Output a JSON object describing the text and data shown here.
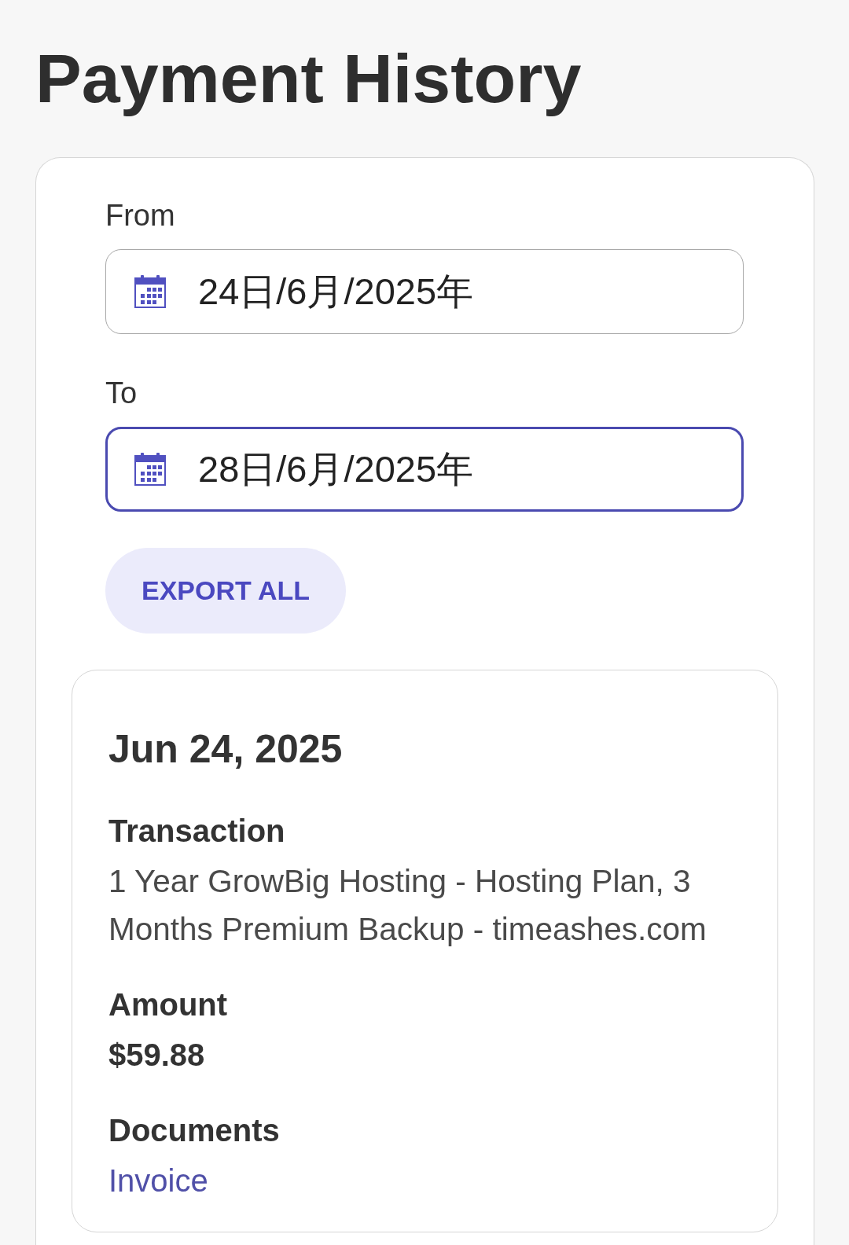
{
  "page": {
    "title": "Payment History"
  },
  "filters": [
    {
      "label": "From",
      "value": "24日/6月/2025年",
      "focused": false
    },
    {
      "label": "To",
      "value": "28日/6月/2025年",
      "focused": true
    }
  ],
  "export_button": {
    "label": "EXPORT ALL"
  },
  "payments": [
    {
      "date": "Jun 24, 2025",
      "fields": [
        {
          "kind": "text",
          "label": "Transaction",
          "value": "1 Year GrowBig Hosting - Hosting Plan, 3 Months Premium Backup - timeashes.com"
        },
        {
          "kind": "amount",
          "label": "Amount",
          "value": "$59.88"
        },
        {
          "kind": "link",
          "label": "Documents",
          "value": "Invoice"
        }
      ]
    }
  ]
}
